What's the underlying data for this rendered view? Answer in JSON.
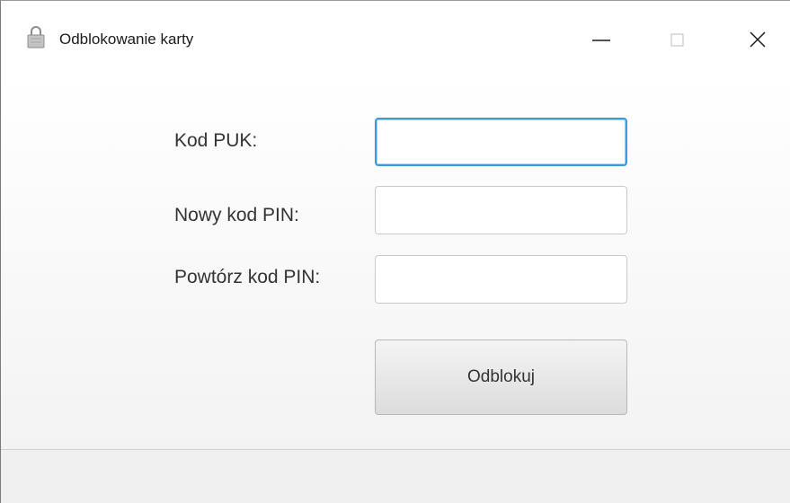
{
  "window": {
    "title": "Odblokowanie karty",
    "icon": "lock-icon",
    "controls": {
      "minimize_icon": "minimize-icon",
      "maximize_icon": "maximize-icon",
      "close_icon": "close-icon"
    }
  },
  "form": {
    "puk_label": "Kod PUK:",
    "puk_value": "",
    "new_pin_label": "Nowy kod PIN:",
    "new_pin_value": "",
    "repeat_pin_label": "Powtórz kod PIN:",
    "repeat_pin_value": "",
    "submit_label": "Odblokuj"
  },
  "colors": {
    "focus_border": "#3c9ad6",
    "text": "#333333"
  }
}
